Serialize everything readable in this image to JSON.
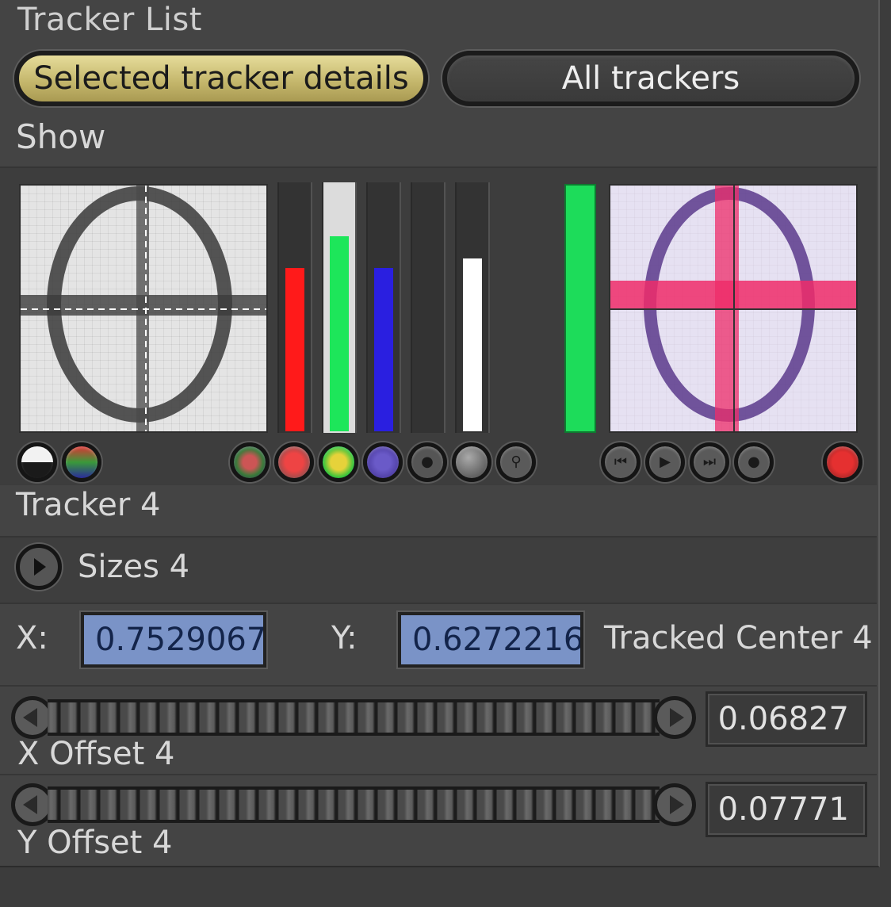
{
  "header": {
    "title": "Tracker List"
  },
  "tabs": {
    "selected_label": "Selected tracker details",
    "all_label": "All trackers"
  },
  "show": {
    "label": "Show"
  },
  "meters": [
    {
      "name": "red-channel-meter",
      "color": "#ff1a1a",
      "fraction": 0.66
    },
    {
      "name": "green-channel-meter",
      "color": "#1de65a",
      "fraction": 0.79,
      "track_color": "#dcdcdc"
    },
    {
      "name": "blue-channel-meter",
      "color": "#2a1fe0",
      "fraction": 0.66
    },
    {
      "name": "empty-meter",
      "color": "#444444",
      "fraction": 0.0
    },
    {
      "name": "white-channel-meter",
      "color": "#ffffff",
      "fraction": 0.7
    }
  ],
  "accent_colors": {
    "selected_tab": "#c9bb6e",
    "field_bg": "#7a93c7",
    "green_bar": "#1ddc5a"
  },
  "tracker": {
    "label": "Tracker 4"
  },
  "sizes": {
    "label": "Sizes 4"
  },
  "center": {
    "x_label": "X:",
    "x_value": "0.7529067",
    "y_label": "Y:",
    "y_value": "0.6272216",
    "label": "Tracked Center 4"
  },
  "x_offset": {
    "label": "X Offset 4",
    "value": "0.06827"
  },
  "y_offset": {
    "label": "Y Offset 4",
    "value": "0.07771"
  }
}
